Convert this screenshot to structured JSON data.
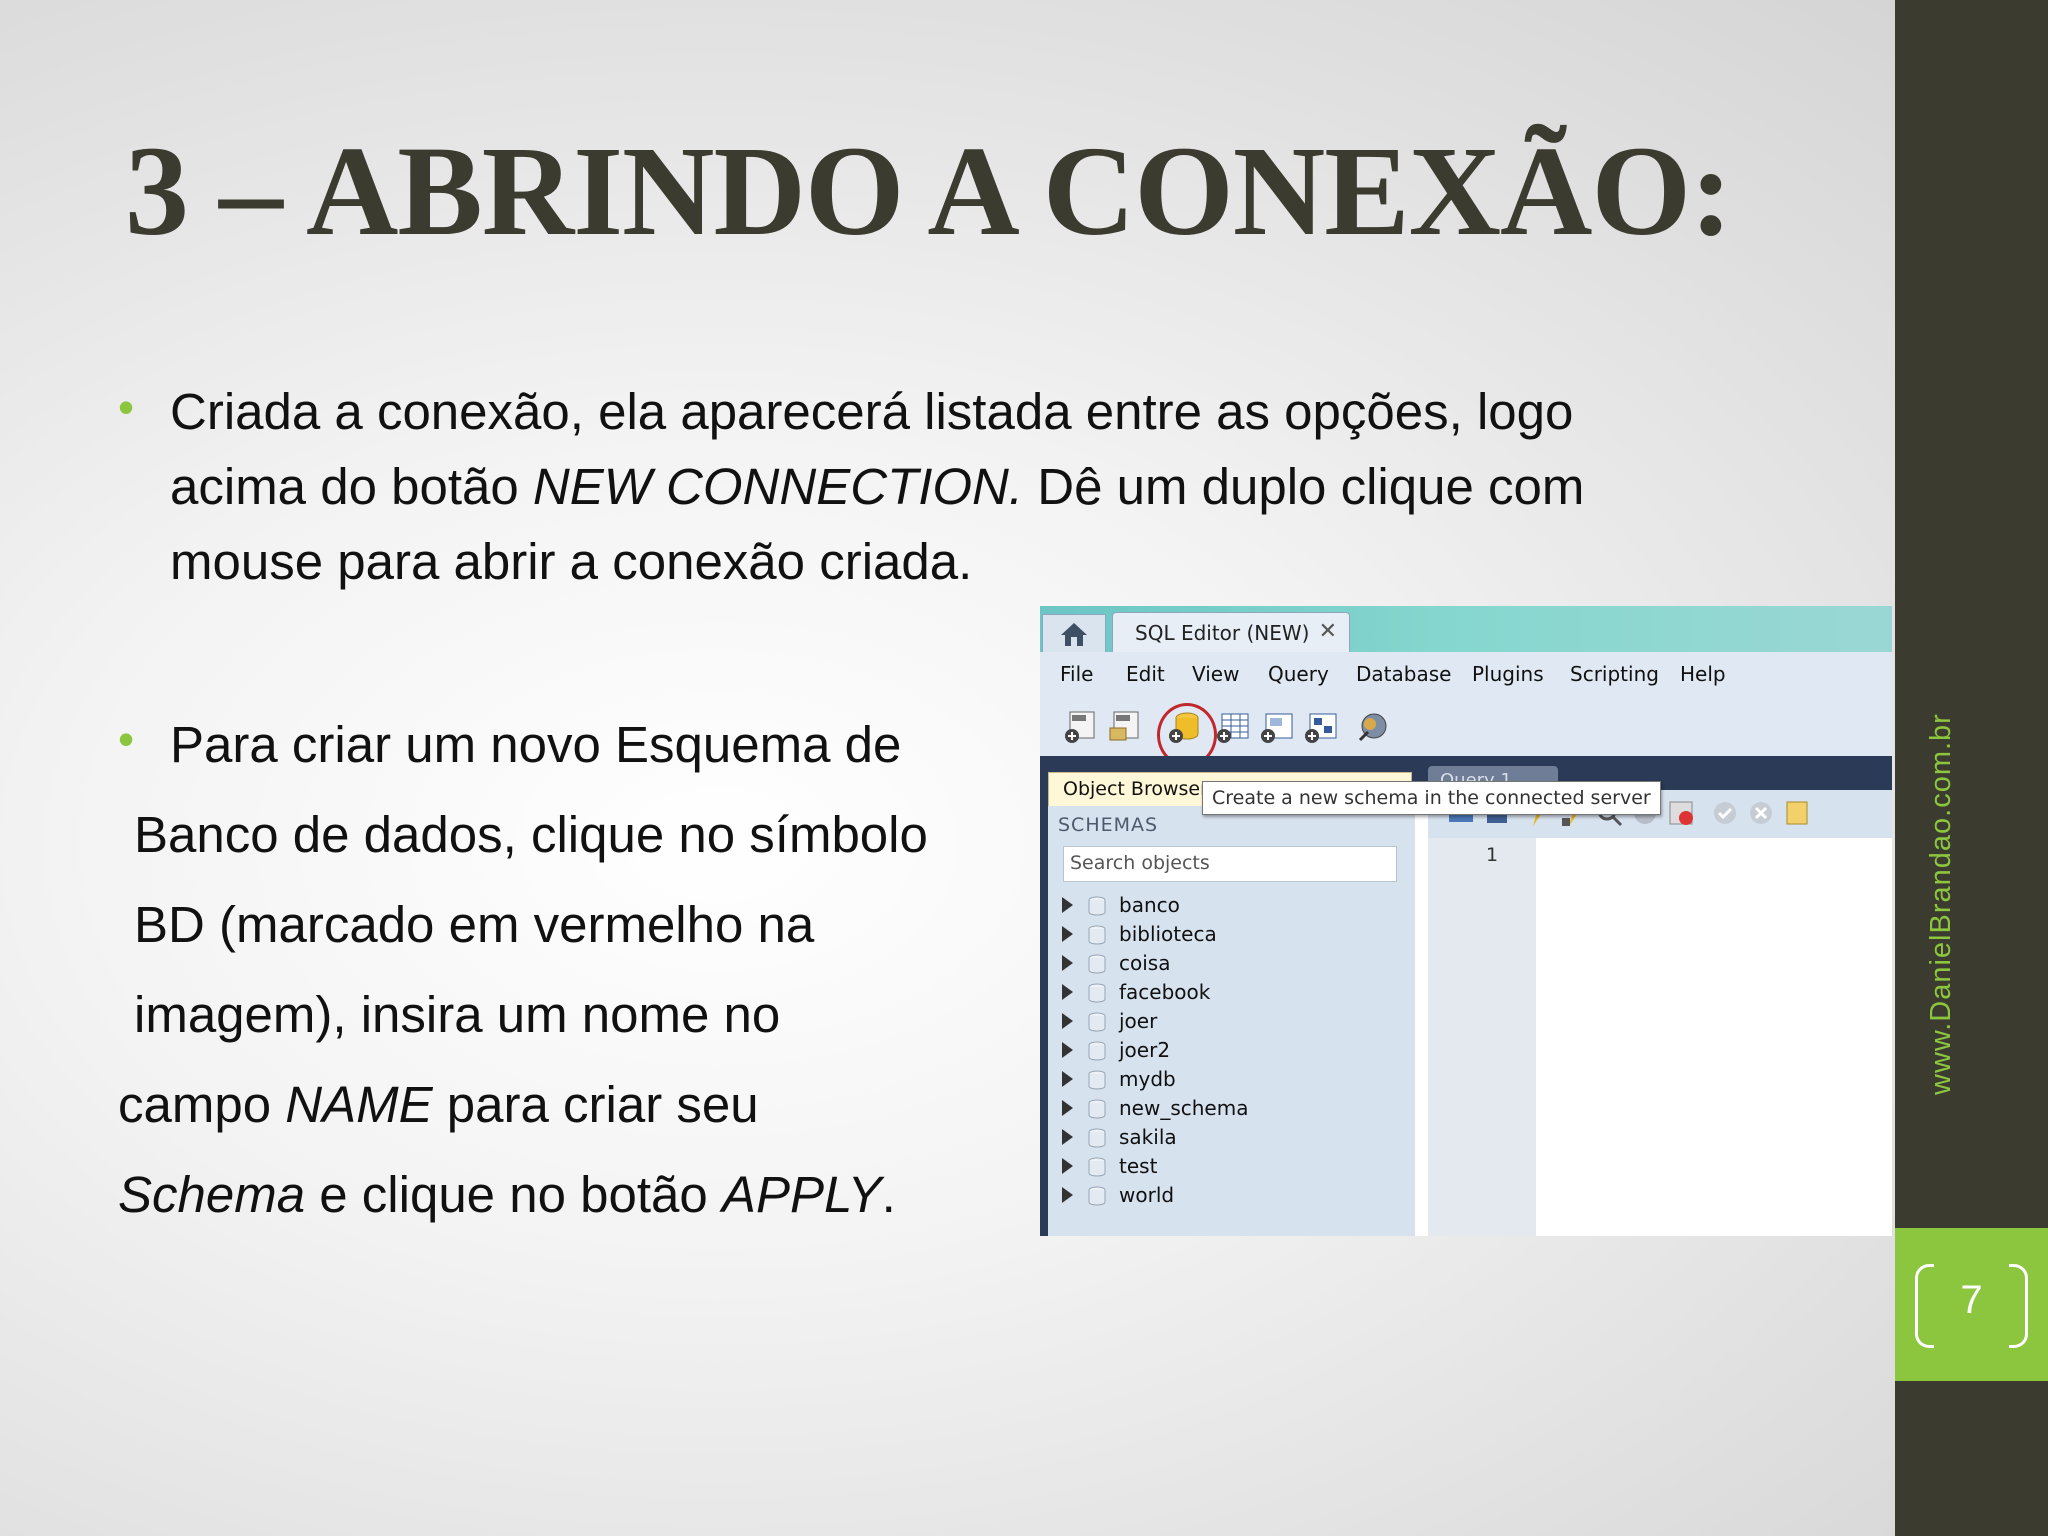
{
  "slide": {
    "title": "3 – ABRINDO A CONEXÃO:",
    "side_url": "www.DanielBrandao.com.br",
    "page_number": "7",
    "bullet_glyph": "•",
    "accent_color": "#8cc63f",
    "bar_color": "#3b3b2f",
    "paragraph1": {
      "line1": "Criada a conexão, ela aparecerá listada entre as opções, logo",
      "line2_pre": "acima do botão ",
      "line2_em": "NEW CONNECTION.",
      "line2_post": " Dê um duplo clique com",
      "line3": "mouse para abrir a conexão criada."
    },
    "paragraph2": {
      "line1": "Para criar um novo Esquema de",
      "line2": "Banco de dados, clique no símbolo",
      "line3": "BD (marcado em vermelho na",
      "line4": "imagem), insira um nome no",
      "line5_pre": "campo ",
      "line5_em": "NAME",
      "line5_post": " para criar seu",
      "line6_em1": "Schema",
      "line6_mid": " e clique no botão ",
      "line6_em2": "APPLY",
      "line6_post": "."
    }
  },
  "screenshot": {
    "tab_label": "SQL Editor (NEW)",
    "tab_close": "✕",
    "menu": [
      "File",
      "Edit",
      "View",
      "Query",
      "Database",
      "Plugins",
      "Scripting",
      "Help"
    ],
    "object_browser_tab": "Object Browser",
    "query_tab": "Query 1",
    "schemas_title": "SCHEMAS",
    "search_placeholder": "Search objects",
    "schemas": [
      "banco",
      "biblioteca",
      "coisa",
      "facebook",
      "joer",
      "joer2",
      "mydb",
      "new_schema",
      "sakila",
      "test",
      "world"
    ],
    "line_number": "1",
    "tooltip": "Create a new schema in the connected server",
    "highlight_color": "#c0282d",
    "toolbar_icons": [
      "new-sql-tab-icon",
      "open-sql-file-icon",
      "create-schema-icon",
      "create-table-icon",
      "create-view-icon",
      "create-routine-icon",
      "search-table-data-icon"
    ]
  }
}
